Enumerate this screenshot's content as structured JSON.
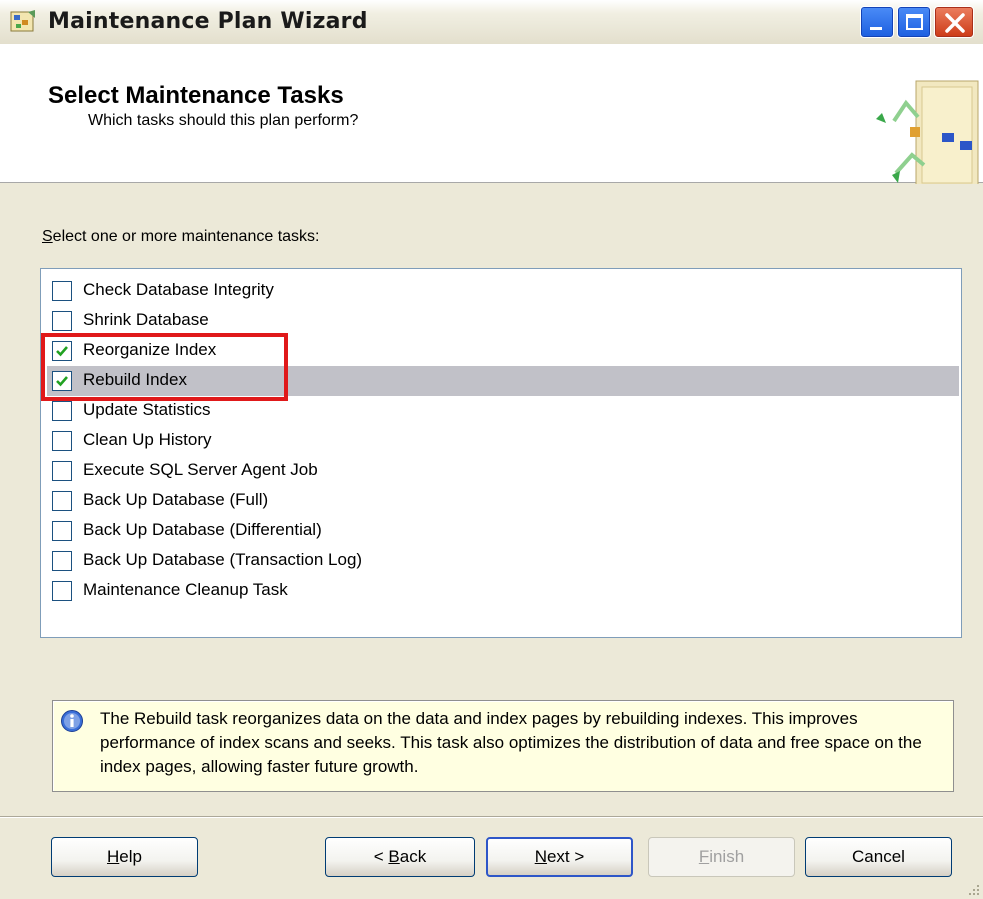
{
  "window": {
    "title": "Maintenance Plan Wizard",
    "colors": {
      "titlebar_button_blue": "#2a6cf0",
      "close_button_red": "#d64a26"
    }
  },
  "header": {
    "title": "Select Maintenance Tasks",
    "subtitle": "Which tasks should this plan perform?"
  },
  "tasks": {
    "label_mnemonic": "S",
    "label_rest": "elect one or more maintenance tasks:",
    "items": [
      {
        "label": "Check Database Integrity",
        "checked": false
      },
      {
        "label": "Shrink Database",
        "checked": false
      },
      {
        "label": "Reorganize Index",
        "checked": true
      },
      {
        "label": "Rebuild Index",
        "checked": true,
        "selected": true
      },
      {
        "label": "Update Statistics",
        "checked": false
      },
      {
        "label": "Clean Up History",
        "checked": false
      },
      {
        "label": "Execute SQL Server Agent Job",
        "checked": false
      },
      {
        "label": "Back Up Database (Full)",
        "checked": false
      },
      {
        "label": "Back Up Database (Differential)",
        "checked": false
      },
      {
        "label": "Back Up Database (Transaction Log)",
        "checked": false
      },
      {
        "label": "Maintenance Cleanup Task",
        "checked": false
      }
    ]
  },
  "info": {
    "text": "The Rebuild task reorganizes data on the data and index pages by rebuilding indexes. This improves performance of index scans and seeks. This task also optimizes the distribution of data and free space on the index pages, allowing faster future growth."
  },
  "buttons": {
    "help": {
      "mnemonic": "H",
      "rest": "elp"
    },
    "back": {
      "prefix": "< ",
      "mnemonic": "B",
      "rest": "ack"
    },
    "next": {
      "mnemonic": "N",
      "rest": "ext >"
    },
    "finish": {
      "mnemonic": "F",
      "rest": "inish"
    },
    "cancel": "Cancel"
  },
  "annotation": {
    "color": "#e0191a"
  }
}
